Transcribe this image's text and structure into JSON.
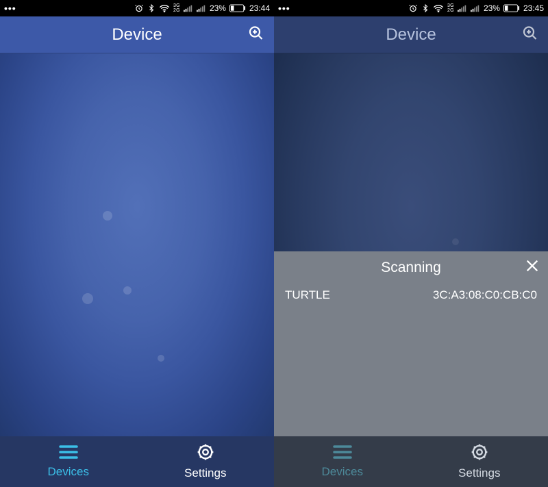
{
  "status": {
    "battery_pct": "23%",
    "time_left": "23:44",
    "time_right": "23:45",
    "net_labels": [
      "3G",
      "2G"
    ]
  },
  "header": {
    "title": "Device",
    "search_icon": "zoom-in-icon"
  },
  "nav": {
    "devices_label": "Devices",
    "settings_label": "Settings",
    "devices_icon": "menu-icon",
    "settings_icon": "gear-icon"
  },
  "scan": {
    "title": "Scanning",
    "close_icon": "close-icon",
    "results": [
      {
        "name": "TURTLE",
        "mac": "3C:A3:08:C0:CB:C0"
      }
    ]
  }
}
